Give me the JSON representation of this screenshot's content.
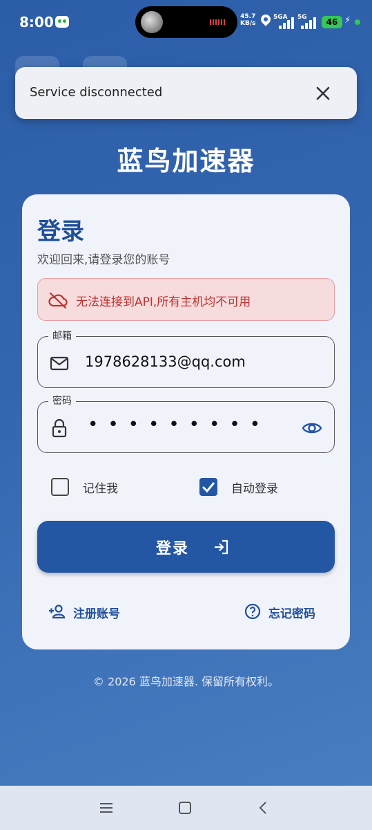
{
  "status_bar": {
    "time": "8:00",
    "speed_value": "45.7",
    "speed_unit": "KB/s",
    "sim1_label": "5GA",
    "sim2_label": "5G",
    "battery": "46"
  },
  "snackbar": {
    "message": "Service disconnected"
  },
  "app_title": "蓝鸟加速器",
  "login": {
    "title": "登录",
    "subtitle": "欢迎回来,请登录您的账号",
    "error": "无法连接到API,所有主机均不可用",
    "email_label": "邮箱",
    "email_value": "1978628133@qq.com",
    "password_label": "密码",
    "password_mask": "•••••••••",
    "remember_label": "记住我",
    "remember_checked": false,
    "auto_login_label": "自动登录",
    "auto_login_checked": true,
    "submit_label": "登录",
    "register_label": "注册账号",
    "forgot_label": "忘记密码"
  },
  "footer": "© 2026 蓝鸟加速器. 保留所有权利。",
  "colors": {
    "primary": "#2356a3",
    "error": "#c0302f",
    "card": "#f1f3fb"
  }
}
